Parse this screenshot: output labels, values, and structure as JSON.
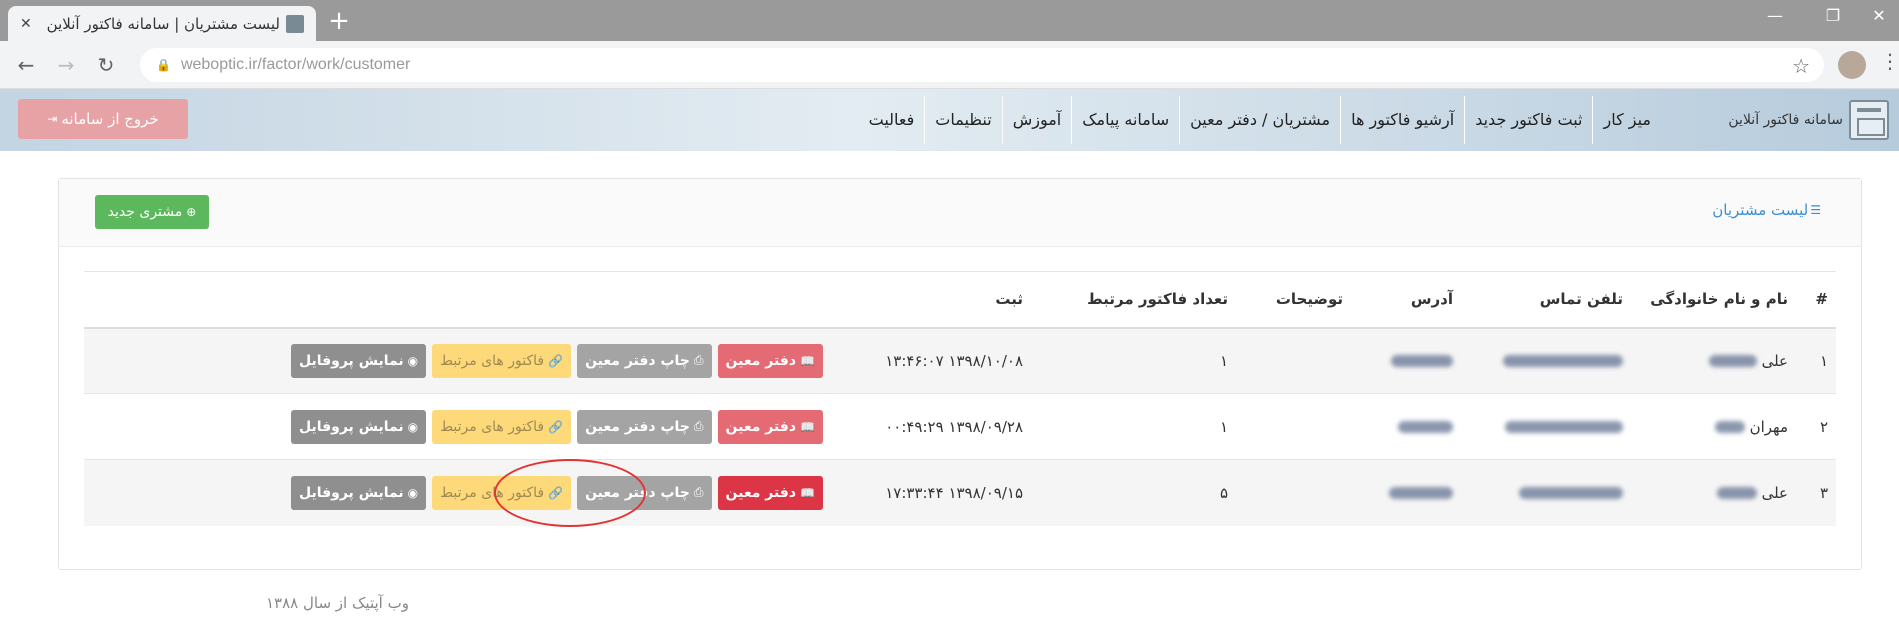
{
  "browser": {
    "tab_title": "لیست مشتریان | سامانه فاکتور آنلاین",
    "url": "weboptic.ir/factor/work/customer"
  },
  "app": {
    "brand": "سامانه فاکتور آنلاین",
    "menu": [
      "میز کار",
      "ثبت فاکتور جدید",
      "آرشیو فاکتور ها",
      "مشتریان / دفتر معین",
      "سامانه پیامک",
      "آموزش",
      "تنظیمات",
      "فعالیت"
    ],
    "logout_label": "خروج از سامانه"
  },
  "panel": {
    "title": "لیست مشتریان",
    "new_customer_label": "مشتری جدید"
  },
  "table": {
    "headers": [
      "#",
      "نام و نام خانوادگی",
      "تلفن تماس",
      "آدرس",
      "توضیحات",
      "تعداد فاکتور مرتبط",
      "ثبت",
      ""
    ],
    "rows": [
      {
        "num": "۱",
        "name": "علی",
        "invoice_count": "۱",
        "registered": "۱۳۹۸/۱۰/۰۸ ۱۳:۴۶:۰۷"
      },
      {
        "num": "۲",
        "name": "مهران",
        "invoice_count": "۱",
        "registered": "۱۳۹۸/۰۹/۲۸ ۰۰:۴۹:۲۹"
      },
      {
        "num": "۳",
        "name": "علی",
        "invoice_count": "۵",
        "registered": "۱۳۹۸/۰۹/۱۵ ۱۷:۳۳:۴۴"
      }
    ],
    "actions": {
      "ledger": "دفتر معین",
      "print_ledger": "چاپ دفتر معین",
      "related_invoices": "فاکتور های مرتبط",
      "show_profile": "نمایش پروفایل"
    }
  },
  "footer": "وب آپتیک از سال ۱۳۸۸",
  "icons": {
    "ledger": "book-icon",
    "print": "printer-icon",
    "related": "link-icon",
    "profile": "eye-icon",
    "list": "list-icon",
    "plus": "plus-circle-icon",
    "logout": "sign-out-icon"
  }
}
